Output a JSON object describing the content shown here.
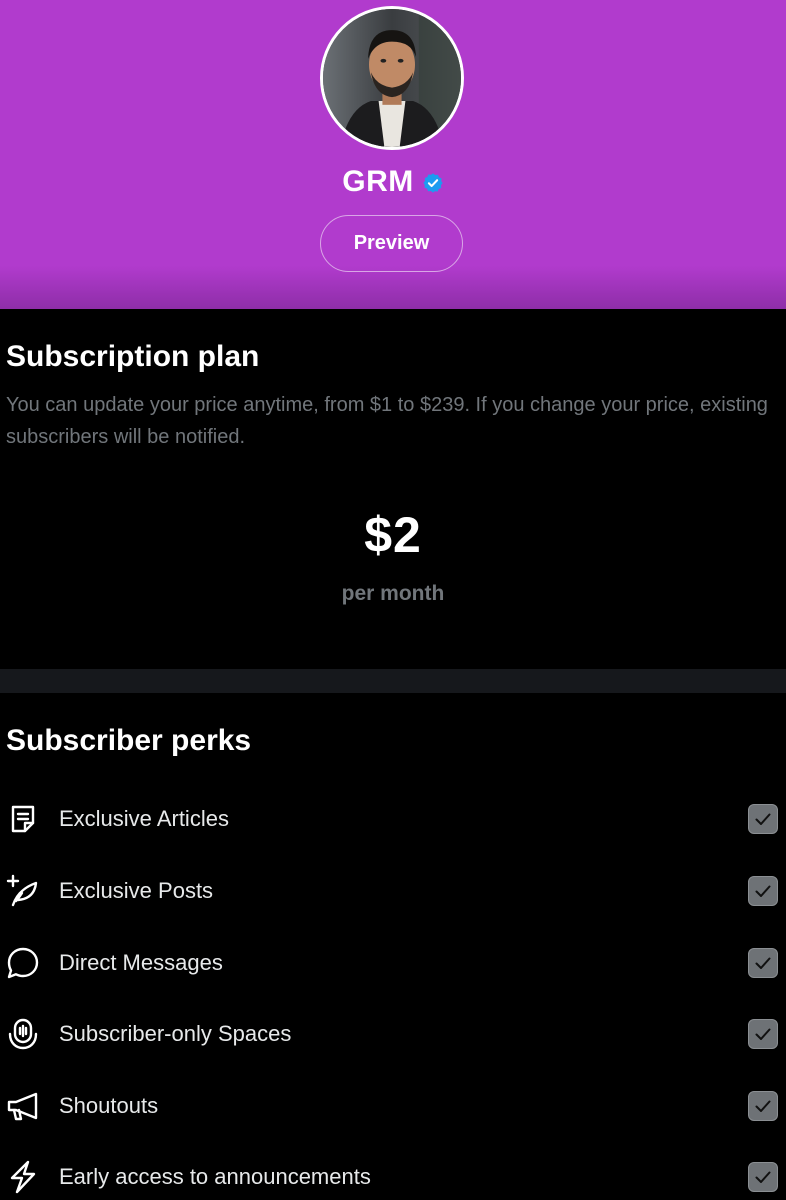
{
  "profile": {
    "name": "GRM",
    "preview_label": "Preview"
  },
  "plan": {
    "title": "Subscription plan",
    "description": "You can update your price anytime, from $1 to $239. If you change your price, existing subscribers will be notified.",
    "price": "$2",
    "period": "per month"
  },
  "perks": {
    "title": "Subscriber perks",
    "items": [
      {
        "label": "Exclusive Articles",
        "icon": "article-icon",
        "checked": true
      },
      {
        "label": "Exclusive Posts",
        "icon": "feather-plus-icon",
        "checked": true
      },
      {
        "label": "Direct Messages",
        "icon": "chat-bubble-icon",
        "checked": true
      },
      {
        "label": "Subscriber-only Spaces",
        "icon": "spaces-mic-icon",
        "checked": true
      },
      {
        "label": "Shoutouts",
        "icon": "megaphone-icon",
        "checked": true
      },
      {
        "label": "Early access to announcements",
        "icon": "lightning-icon",
        "checked": true
      }
    ]
  },
  "colors": {
    "header_purple": "#b13bcd",
    "verified_blue": "#1d9bf0",
    "muted_text": "#71767b",
    "checkbox_gray": "#6e7276"
  }
}
